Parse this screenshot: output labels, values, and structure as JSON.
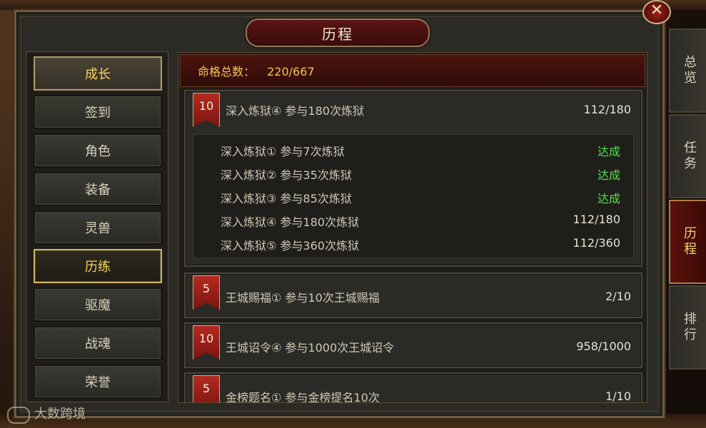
{
  "window": {
    "title": "历程"
  },
  "menu": {
    "items": [
      {
        "label": "成长"
      },
      {
        "label": "签到"
      },
      {
        "label": "角色"
      },
      {
        "label": "装备"
      },
      {
        "label": "灵兽"
      },
      {
        "label": "历练"
      },
      {
        "label": "驱魔"
      },
      {
        "label": "战魂"
      },
      {
        "label": "荣誉"
      }
    ],
    "active_index": 5
  },
  "summary": {
    "label": "命格总数：",
    "value": "220/667"
  },
  "groups": [
    {
      "badge": "10",
      "title": "深入炼狱④ 参与180次炼狱",
      "progress": "112/180",
      "subitems": [
        {
          "label": "深入炼狱① 参与7次炼狱",
          "status": "达成"
        },
        {
          "label": "深入炼狱② 参与35次炼狱",
          "status": "达成"
        },
        {
          "label": "深入炼狱③ 参与85次炼狱",
          "status": "达成"
        },
        {
          "label": "深入炼狱④ 参与180次炼狱",
          "status": "112/180"
        },
        {
          "label": "深入炼狱⑤ 参与360次炼狱",
          "status": "112/360"
        }
      ]
    },
    {
      "badge": "5",
      "title": "王城赐福① 参与10次王城赐福",
      "progress": "2/10"
    },
    {
      "badge": "10",
      "title": "王城诏令④ 参与1000次王城诏令",
      "progress": "958/1000"
    },
    {
      "badge": "5",
      "title": "金榜题名① 参与金榜提名10次",
      "progress": "1/10"
    }
  ],
  "tabs": [
    {
      "label": "总览"
    },
    {
      "label": "任务"
    },
    {
      "label": "历程"
    },
    {
      "label": "排行"
    }
  ],
  "close": {
    "label": "✕"
  },
  "watermark": {
    "text": "大数跨境"
  },
  "colors": {
    "done": "#53e34b",
    "accent_gold": "#f3d45c",
    "ribbon_red": "#b52a20"
  }
}
